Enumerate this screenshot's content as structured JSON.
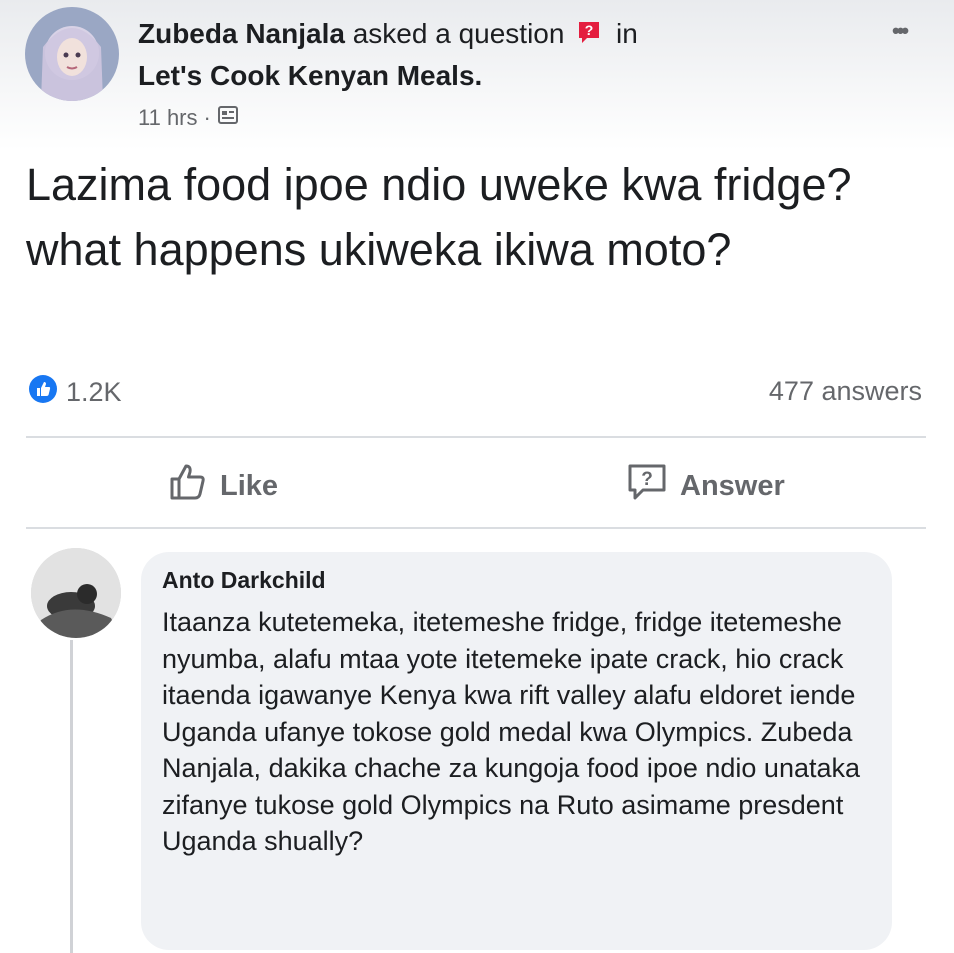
{
  "post": {
    "author": "Zubeda Nanjala",
    "action_text": "asked a question",
    "in_text": "in",
    "group": "Let's Cook Kenyan Meals.",
    "time": "11 hrs",
    "separator": "·",
    "question": "Lazima food ipoe ndio uweke kwa fridge?what happens ukiweka ikiwa moto?",
    "reaction_count": "1.2K",
    "answers_count": "477 answers"
  },
  "actions": {
    "like_label": "Like",
    "answer_label": "Answer"
  },
  "comment": {
    "author": "Anto Darkchild",
    "text": "Itaanza kutetemeka, itetemeshe fridge, fridge itetemeshe nyumba, alafu mtaa yote itetemeke ipate crack, hio crack itaenda igawanye Kenya kwa rift valley alafu eldoret iende Uganda ufanye tokose gold medal kwa Olympics. Zubeda Nanjala, dakika chache za kungoja food ipoe ndio unataka zifanye tukose gold Olympics na Ruto asimame presdent Uganda shually?"
  },
  "icons": {
    "question_badge": "question-badge-icon",
    "group_icon": "group-icon",
    "like_reaction": "like-reaction-icon",
    "like_button": "thumbs-up-icon",
    "answer_button": "question-bubble-icon",
    "more": "more-dots-icon"
  },
  "colors": {
    "brand_blue": "#1877f2",
    "question_red": "#e41e3f",
    "muted_text": "#65676b",
    "bubble_bg": "#f0f2f5"
  }
}
